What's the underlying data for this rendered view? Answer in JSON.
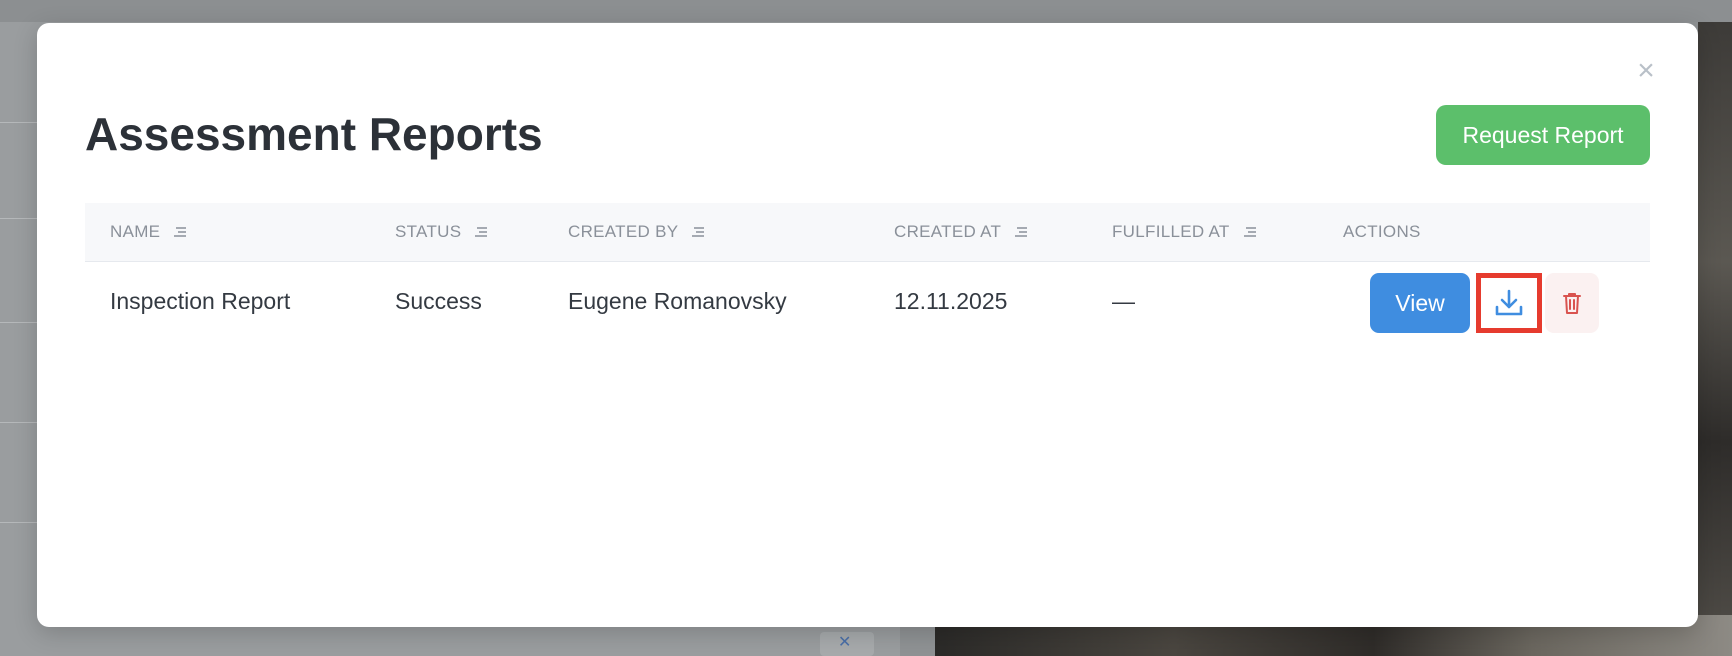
{
  "modal": {
    "title": "Assessment Reports",
    "request_button_label": "Request Report",
    "close_icon": "close-icon"
  },
  "table": {
    "columns": [
      {
        "label": "NAME",
        "sortable": true
      },
      {
        "label": "STATUS",
        "sortable": true
      },
      {
        "label": "CREATED BY",
        "sortable": true
      },
      {
        "label": "CREATED AT",
        "sortable": true
      },
      {
        "label": "FULFILLED AT",
        "sortable": true
      },
      {
        "label": "ACTIONS",
        "sortable": false
      }
    ],
    "rows": [
      {
        "name": "Inspection Report",
        "status": "Success",
        "created_by": "Eugene Romanovsky",
        "created_at": "12.11.2025",
        "fulfilled_at": "—",
        "actions": {
          "view_label": "View",
          "download_icon": "download-icon",
          "delete_icon": "trash-icon"
        }
      }
    ]
  },
  "colors": {
    "primary": "#3f8de0",
    "success": "#5cbf6b",
    "danger": "#d9534f",
    "highlight": "#e63b2e"
  }
}
